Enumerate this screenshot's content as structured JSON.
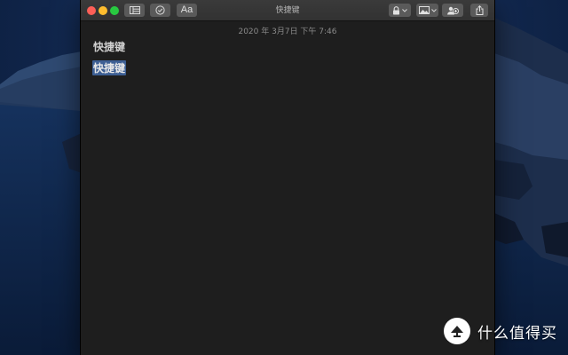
{
  "window": {
    "title": "快捷键",
    "toolbar": {
      "list_view_icon": "table-icon",
      "checklist_icon": "checklist-icon",
      "format_label": "Aa",
      "lock_icon": "lock-icon",
      "attachment_icon": "photo-icon",
      "collaborate_icon": "add-people-icon",
      "share_icon": "share-icon"
    }
  },
  "note": {
    "date": "2020 年 3月7日 下午 7:46",
    "heading": "快捷键",
    "selected_line": "快捷键"
  },
  "watermark": {
    "logo_char": "值",
    "text": "什么值得买"
  },
  "colors": {
    "close": "#fe5f57",
    "minimize": "#febc2e",
    "maximize": "#28c840",
    "selection": "#3d5f94",
    "window_bg": "#1e1e1e"
  }
}
